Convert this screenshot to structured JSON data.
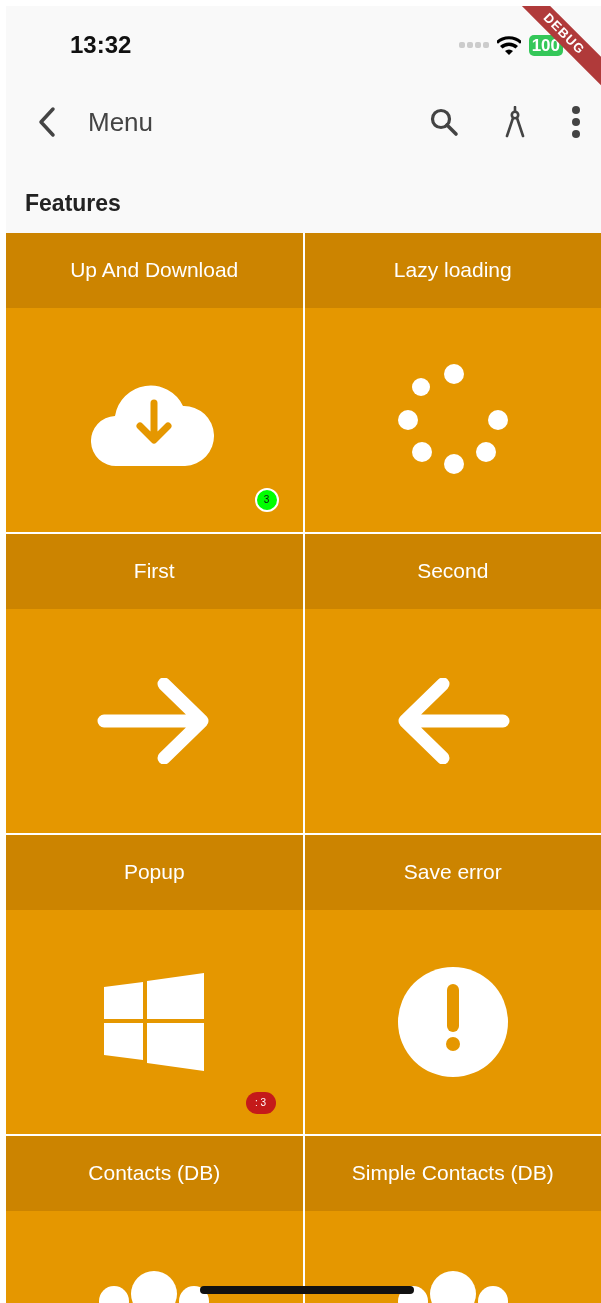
{
  "status_bar": {
    "time": "13:32",
    "battery": "100"
  },
  "debug_banner": "DEBUG",
  "app_bar": {
    "title": "Menu"
  },
  "section_title": "Features",
  "tiles": [
    {
      "title": "Up And Download",
      "kind": "cloud",
      "badge": {
        "text": "3",
        "color": "#00ff00"
      }
    },
    {
      "title": "Lazy loading",
      "kind": "spinner"
    },
    {
      "title": "First",
      "kind": "forward"
    },
    {
      "title": "Second",
      "kind": "backward"
    },
    {
      "title": "Popup",
      "kind": "windows",
      "badge": {
        "text": ": 3",
        "color": "#c41a1a"
      }
    },
    {
      "title": "Save error",
      "kind": "alert"
    },
    {
      "title": "Contacts (DB)",
      "kind": "people"
    },
    {
      "title": "Simple Contacts (DB)",
      "kind": "people"
    }
  ]
}
